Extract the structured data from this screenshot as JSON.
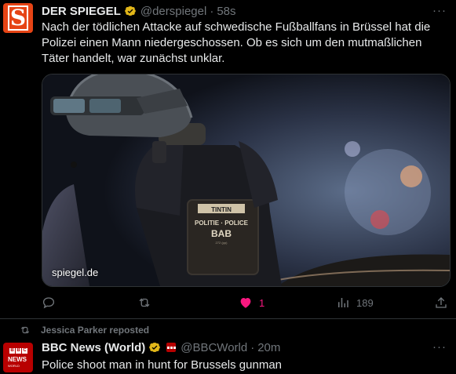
{
  "tweet1": {
    "display_name": "DER SPIEGEL",
    "handle": "@derspiegel",
    "separator": "·",
    "time": "58s",
    "more": "···",
    "text": "Nach der tödlichen Attacke auf schwedische Fußballfans in Brüssel hat die Polizei einen Mann niedergeschossen. Ob es sich um den mutmaßlichen Täter handelt, war zunächst unklar.",
    "media_caption": "spiegel.de",
    "patch_top": "TINTIN",
    "patch_line1": "POLITIE · POLICE",
    "patch_line2": "BAB",
    "patch_line3": "272 (pp)",
    "avatar_letter": "S",
    "likes": "1",
    "views": "189",
    "like_color": "#f91880",
    "avatar_color": "#e64415"
  },
  "tweet2": {
    "reposted_by": "Jessica Parker reposted",
    "display_name": "BBC News (World)",
    "handle": "@BBCWorld",
    "separator": "·",
    "time": "20m",
    "more": "···",
    "text": "Police shoot man in hunt for Brussels gunman",
    "avatar_b1": "B",
    "avatar_b2": "B",
    "avatar_b3": "C",
    "avatar_news": "NEWS",
    "avatar_world": "WORLD",
    "avatar_color": "#b80000"
  },
  "icons": {
    "reply": "reply-icon",
    "repost": "repost-icon",
    "like": "heart-icon",
    "views": "views-icon",
    "share": "share-icon",
    "verified": "verified-badge-icon"
  }
}
